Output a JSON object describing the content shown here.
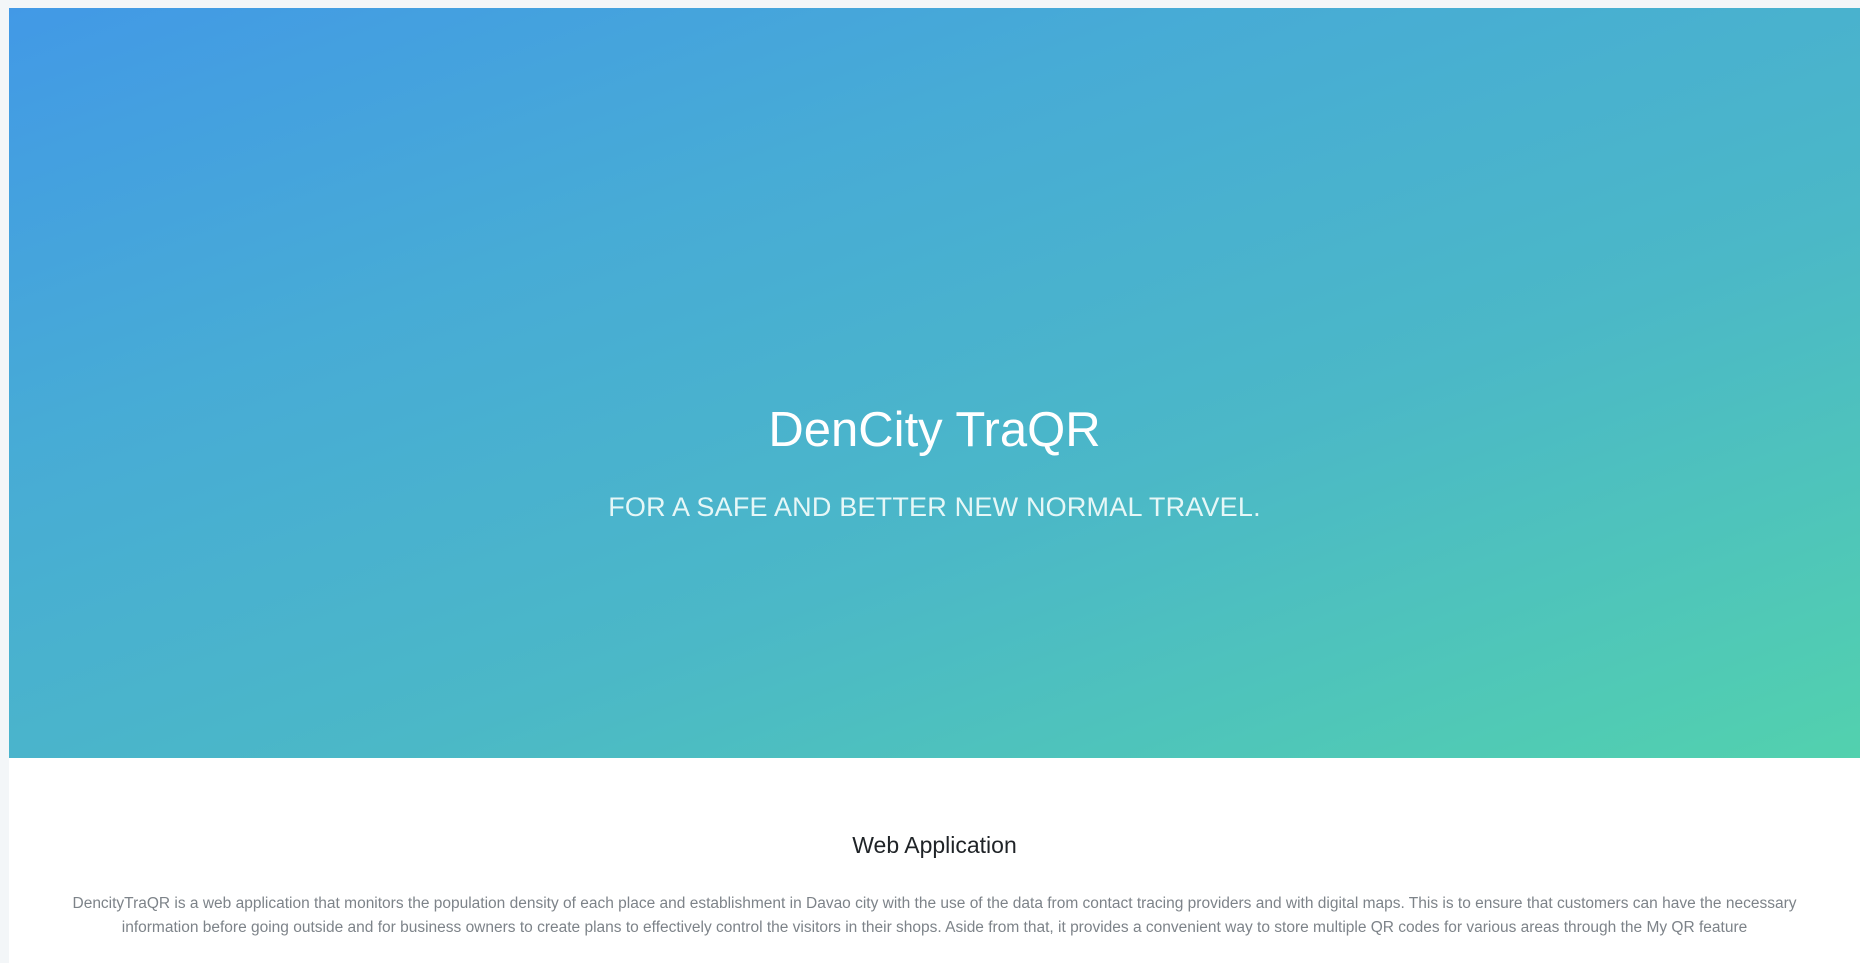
{
  "hero": {
    "title": "DenCity TraQR",
    "subtitle": "FOR A SAFE AND BETTER NEW NORMAL TRAVEL."
  },
  "about": {
    "heading": "Web Application",
    "description": "DencityTraQR is a web application that monitors the population density of each place and establishment in Davao city with the use of the data from contact tracing providers and with digital maps. This is to ensure that customers can have the necessary information before going outside and for business owners to create plans to effectively control the visitors in their shops. Aside from that, it provides a convenient way to store multiple QR codes for various areas through the My QR feature"
  },
  "colors": {
    "gradient_start": "#4299e6",
    "gradient_end": "#52d1ae",
    "heading_text": "#1f2327",
    "body_text": "#7d8389"
  }
}
